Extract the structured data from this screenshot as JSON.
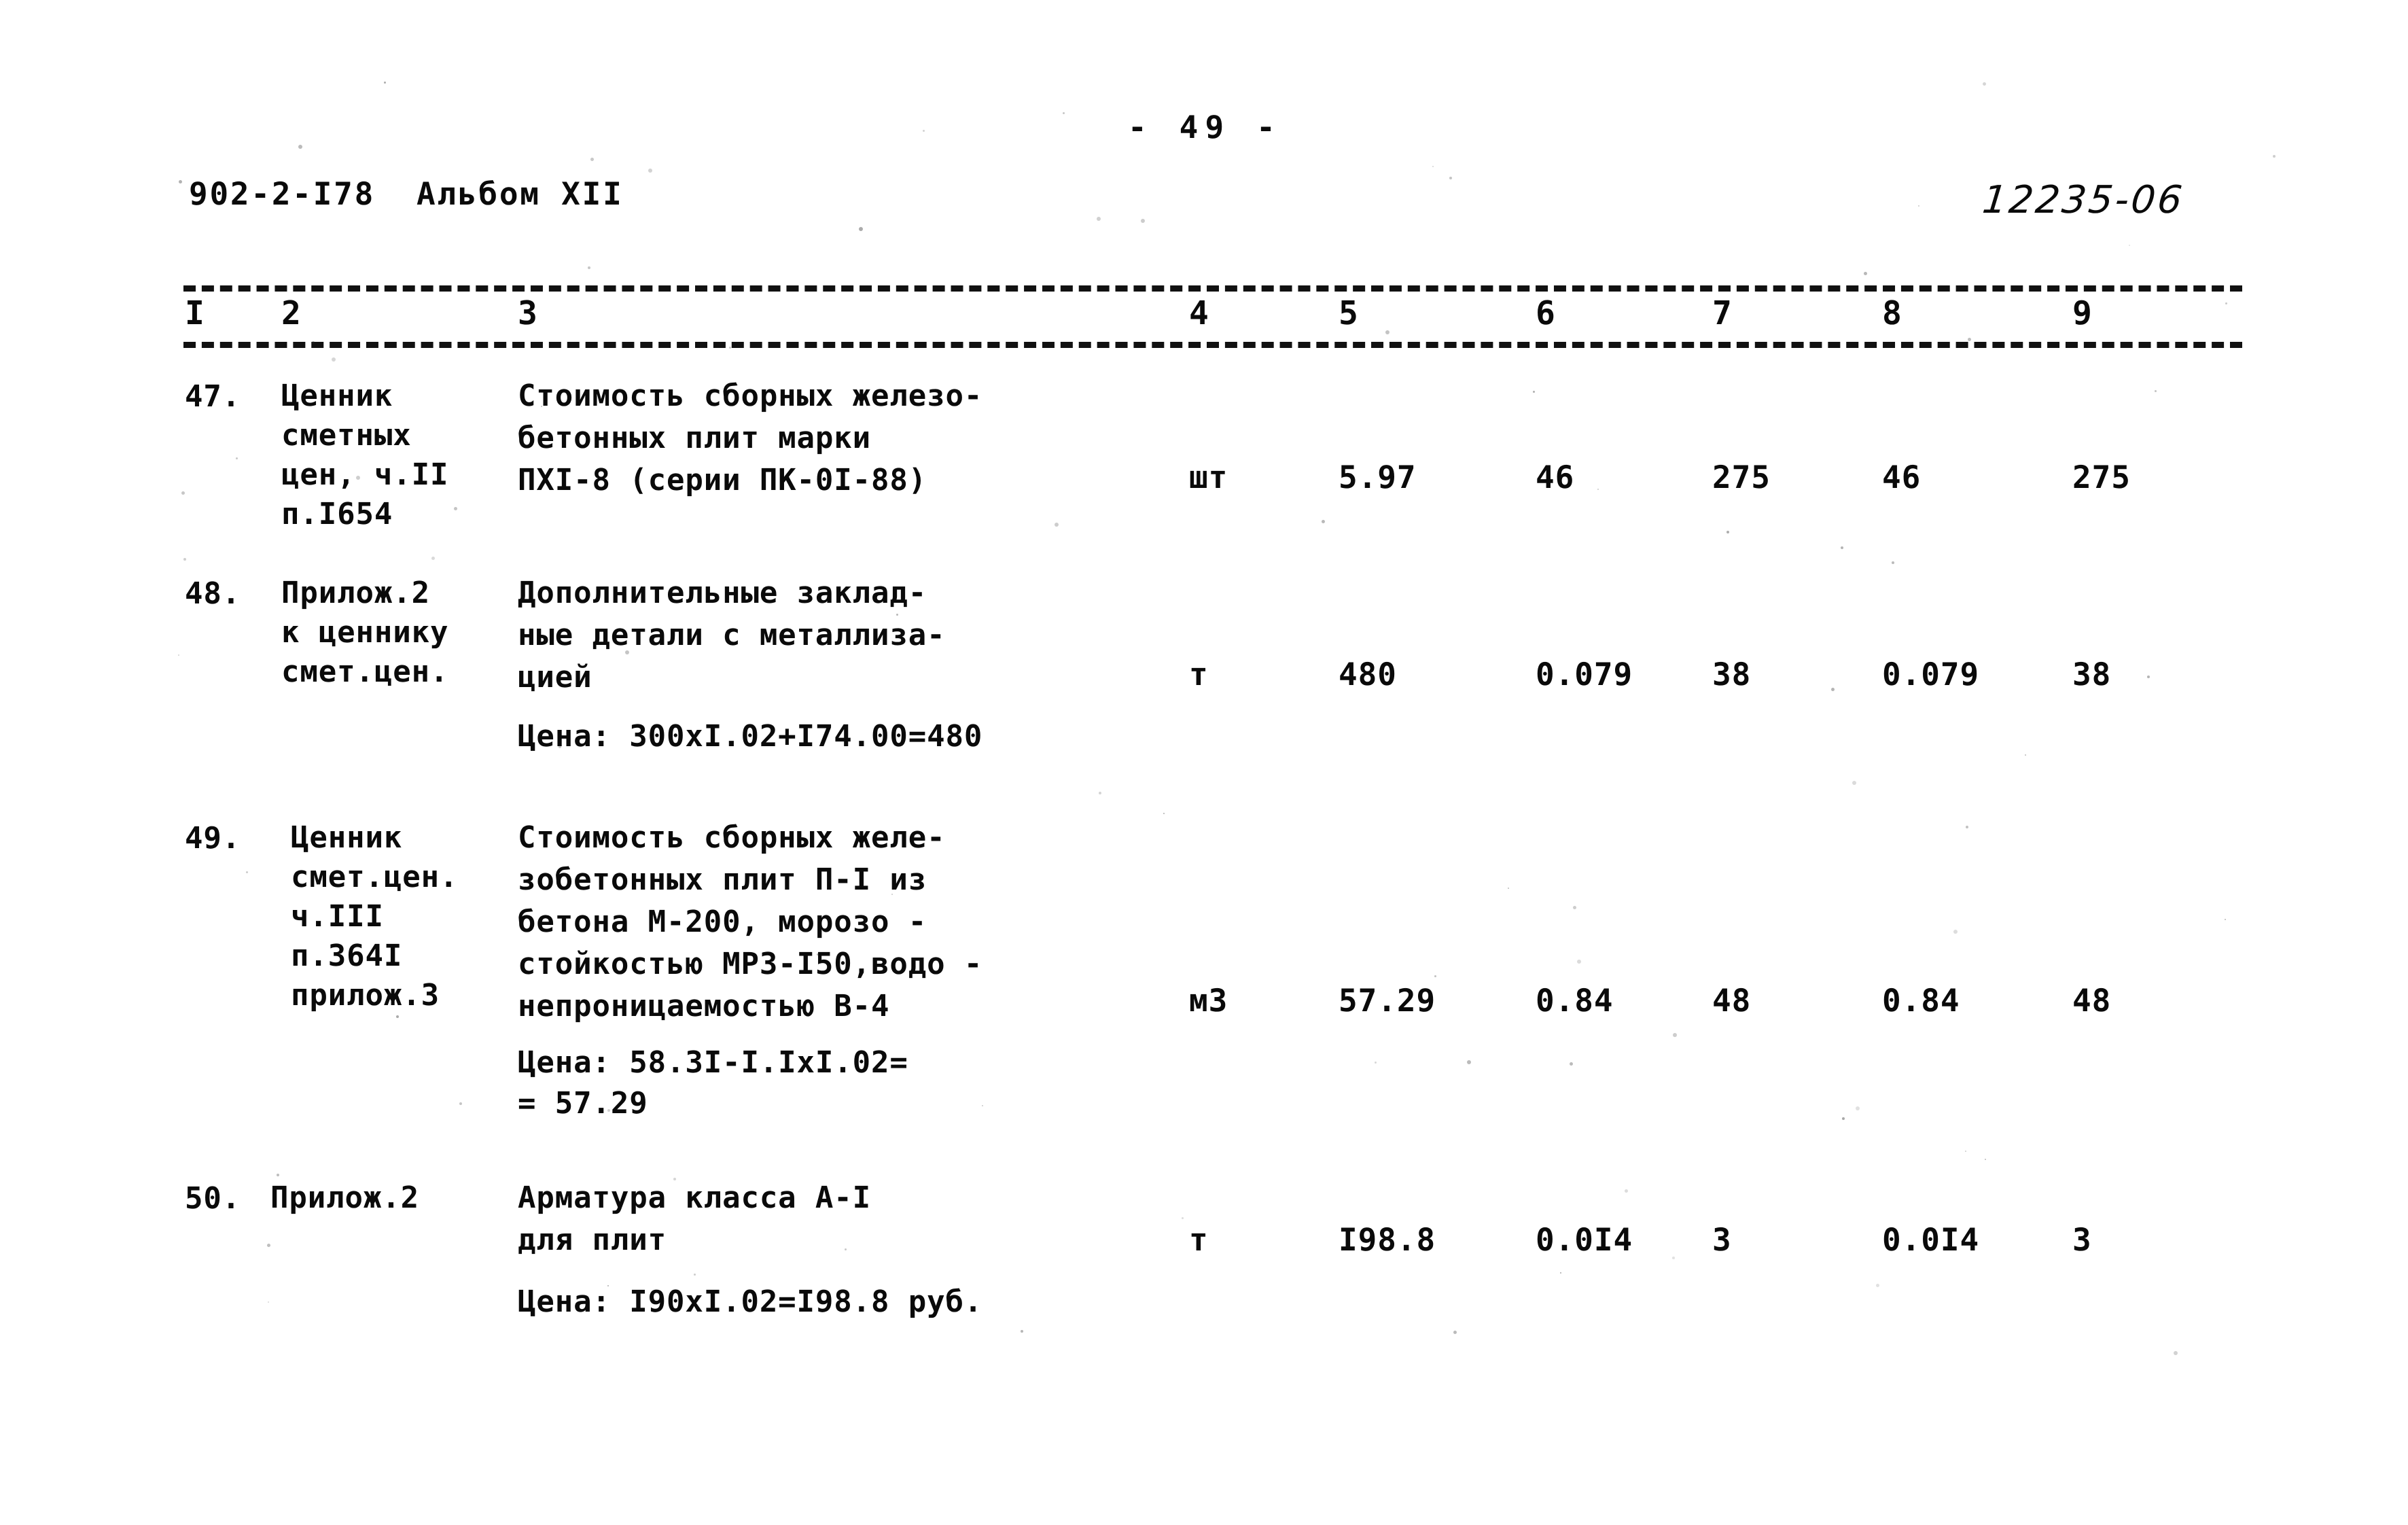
{
  "header": {
    "page_number": "- 49 -",
    "doc_code": "902-2-I78  Альбом XII",
    "archive_number": "12235-06"
  },
  "table": {
    "column_headers": [
      "I",
      "2",
      "3",
      "4",
      "5",
      "6",
      "7",
      "8",
      "9"
    ],
    "rows": [
      {
        "num": "47.",
        "reference": "Ценник\nсметных\nцен, ч.II\nп.I654",
        "description": "Стоимость сборных железо-\nбетонных плит марки\nПХI-8 (серии ПК-0I-88)",
        "unit": "шт",
        "price": "5.97",
        "qty1": "46",
        "sum1": "275",
        "qty2": "46",
        "sum2": "275",
        "note": ""
      },
      {
        "num": "48.",
        "reference": "Прилож.2\nк ценнику\nсмет.цен.",
        "description": "Дополнительные заклад-\nные детали с металлиза-\nцией",
        "unit": "т",
        "price": "480",
        "qty1": "0.079",
        "sum1": "38",
        "qty2": "0.079",
        "sum2": "38",
        "note": "Цена: 300xI.02+I74.00=480"
      },
      {
        "num": "49.",
        "reference": "Ценник\nсмет.цен.\nч.III\nп.364I\nприлож.3",
        "description": "Стоимость сборных желе-\nзобетонных плит П-I из\nбетона М-200, морозо -\nстойкостью МРЗ-I50,водо -\nнепроницаемостью В-4",
        "unit": "м3",
        "price": "57.29",
        "qty1": "0.84",
        "sum1": "48",
        "qty2": "0.84",
        "sum2": "48",
        "note": "Цена: 58.3I-I.IxI.02=\n= 57.29"
      },
      {
        "num": "50.",
        "reference": "Прилож.2",
        "description": "Арматура класса А-I\nдля плит",
        "unit": "т",
        "price": "I98.8",
        "qty1": "0.0I4",
        "sum1": "3",
        "qty2": "0.0I4",
        "sum2": "3",
        "note": "Цена: I90xI.02=I98.8 руб."
      }
    ]
  }
}
